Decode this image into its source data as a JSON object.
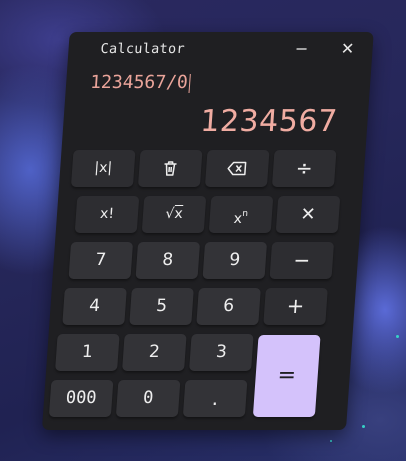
{
  "window": {
    "title": "Calculator",
    "minimize_label": "−",
    "close_label": "✕"
  },
  "display": {
    "expression": "1234567/0",
    "result": "1234567"
  },
  "keys": {
    "abs": "|x|",
    "factorial": "x!",
    "sqrt_symbol": "√",
    "sqrt_var": "x",
    "power_base": "x",
    "power_exp": "n",
    "divide": "÷",
    "multiply": "✕",
    "subtract": "−",
    "add": "+",
    "equals": "=",
    "seven": "7",
    "eight": "8",
    "nine": "9",
    "four": "4",
    "five": "5",
    "six": "6",
    "one": "1",
    "two": "2",
    "three": "3",
    "triple_zero": "000",
    "zero": "0",
    "decimal": "."
  },
  "icons": {
    "clear": "trash-icon",
    "backspace": "backspace-icon"
  },
  "colors": {
    "result_text": "#f0aca2",
    "expression_text": "#eaa49a",
    "equals_key": "#d4c2fb",
    "panel": "#1f1f22",
    "key": "#333337"
  }
}
